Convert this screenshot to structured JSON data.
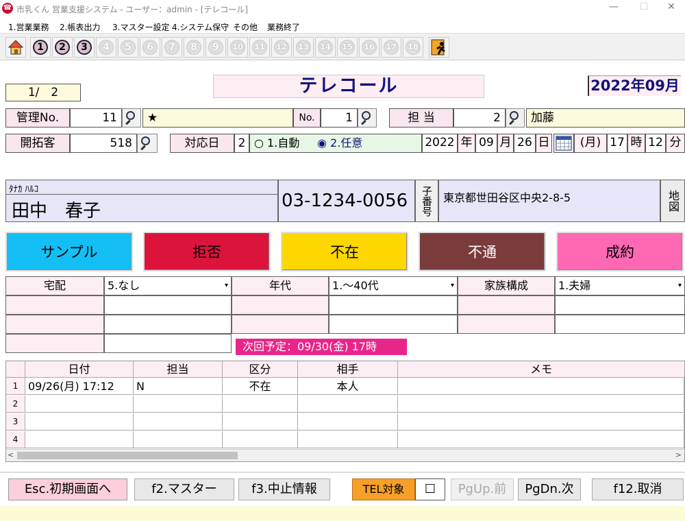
{
  "window": {
    "title": "市乳くん 営業支援システム - ユーザー：admin - [テレコール]",
    "minimize": "—",
    "maximize": "☐",
    "close": "✕"
  },
  "menu": [
    "1.営業業務",
    "2.帳表出力",
    "3.マスター設定",
    "4.システム保守",
    "その他",
    "業務終了"
  ],
  "toolbar": {
    "numbers": [
      "1",
      "2",
      "3",
      "4",
      "5",
      "6",
      "7",
      "8",
      "9",
      "10",
      "11",
      "12",
      "13",
      "14",
      "15",
      "16",
      "17",
      "18"
    ],
    "active_count": 3
  },
  "page": {
    "counter": "1/　2",
    "heading": "テレコール",
    "period": "2022年09月"
  },
  "row1": {
    "kanri_label": "管理No.",
    "kanri_value": "11",
    "star": "★",
    "no_label": "No.",
    "no_value": "1",
    "tanto_label": "担 当",
    "tanto_value": "2",
    "tanto_name": "加藤"
  },
  "row2": {
    "kaitaku_label": "開拓客",
    "kaitaku_value": "518",
    "taiou_label": "対応日",
    "mode_value": "2",
    "radio1": "1.自動",
    "radio2": "2.任意",
    "year": "2022",
    "year_u": "年",
    "month": "09",
    "month_u": "月",
    "day": "26",
    "day_u": "日",
    "weekday": "(月)",
    "hour": "17",
    "hour_u": "時",
    "minute": "12",
    "minute_u": "分"
  },
  "customer": {
    "kana": "ﾀﾅｶ ﾊﾙｺ",
    "name": "田中　春子",
    "phone": "03-1234-0056",
    "kobango": "子番号",
    "address": "東京都世田谷区中央2-8-5",
    "map": "地図"
  },
  "results": [
    {
      "label": "サンプル",
      "bg": "#13bff5",
      "fg": "#000"
    },
    {
      "label": "拒否",
      "bg": "#dc143c",
      "fg": "#000"
    },
    {
      "label": "不在",
      "bg": "#ffd700",
      "fg": "#000"
    },
    {
      "label": "不通",
      "bg": "#7a3b3b",
      "fg": "#fff"
    },
    {
      "label": "成約",
      "bg": "#ff69b4",
      "fg": "#000"
    }
  ],
  "attrs": {
    "takuhai_label": "宅配",
    "takuhai_value": "5.なし",
    "nendai_label": "年代",
    "nendai_value": "1.～40代",
    "kazoku_label": "家族構成",
    "kazoku_value": "1.夫婦"
  },
  "next_plan": "次回予定：09/30(金) 17時",
  "history": {
    "columns": [
      "日付",
      "担当",
      "区分",
      "相手",
      "メモ"
    ],
    "rows": [
      {
        "n": "1",
        "date": "09/26(月) 17:12",
        "tanto": "N",
        "kubun": "不在",
        "aite": "本人",
        "memo": ""
      },
      {
        "n": "2",
        "date": "",
        "tanto": "",
        "kubun": "",
        "aite": "",
        "memo": ""
      },
      {
        "n": "3",
        "date": "",
        "tanto": "",
        "kubun": "",
        "aite": "",
        "memo": ""
      },
      {
        "n": "4",
        "date": "",
        "tanto": "",
        "kubun": "",
        "aite": "",
        "memo": ""
      }
    ]
  },
  "footer": {
    "esc": "Esc.初期画面へ",
    "f2": "f2.マスター",
    "f3": "f3.中止情報",
    "tel": "TEL対象",
    "check": "☐",
    "pgup": "PgUp.前",
    "pgdn": "PgDn.次",
    "f12": "f12.取消"
  }
}
